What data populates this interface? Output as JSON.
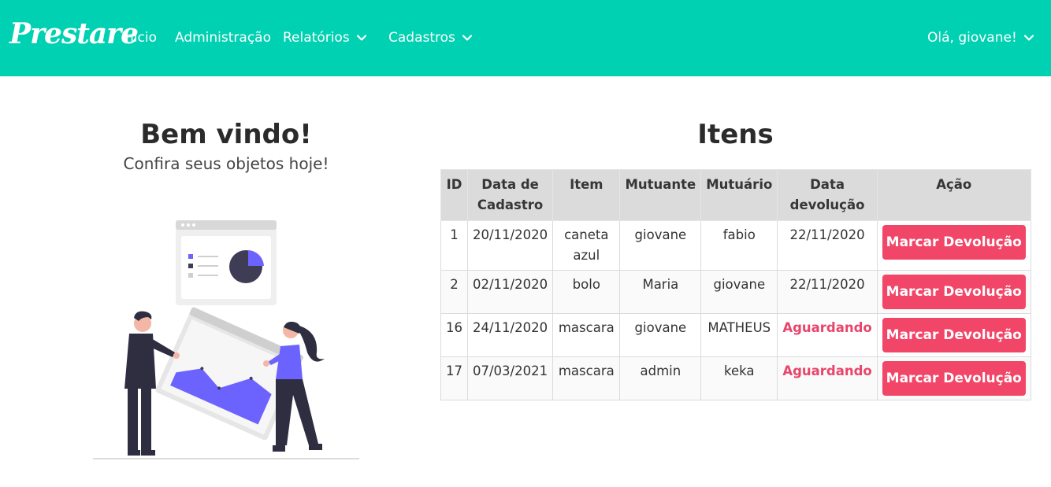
{
  "navbar": {
    "brand": "Prestare",
    "items": [
      {
        "label": "Inicio"
      },
      {
        "label": "Administração"
      },
      {
        "label": "Relatórios"
      },
      {
        "label": "Cadastros"
      }
    ],
    "user_greeting": "Olá, giovane!"
  },
  "welcome": {
    "title": "Bem vindo!",
    "subtitle": "Confira seus objetos hoje!"
  },
  "items_section": {
    "title": "Itens",
    "headers": [
      "ID",
      "Data de Cadastro",
      "Item",
      "Mutuante",
      "Mutuário",
      "Data devolução",
      "Ação"
    ],
    "rows": [
      {
        "id": "1",
        "created": "20/11/2020",
        "item": "caneta azul",
        "lender": "giovane",
        "borrower": "fabio",
        "return_date": "22/11/2020",
        "action": "Marcar Devolução"
      },
      {
        "id": "2",
        "created": "02/11/2020",
        "item": "bolo",
        "lender": "Maria",
        "borrower": "giovane",
        "return_date": "22/11/2020",
        "action": "Marcar Devolução"
      },
      {
        "id": "16",
        "created": "24/11/2020",
        "item": "mascara",
        "lender": "giovane",
        "borrower": "MATHEUS",
        "return_date": "Aguardando",
        "action": "Marcar Devolução"
      },
      {
        "id": "17",
        "created": "07/03/2021",
        "item": "mascara",
        "lender": "admin",
        "borrower": "keka",
        "return_date": "Aguardando",
        "action": "Marcar Devolução"
      }
    ]
  },
  "colors": {
    "navbar_bg": "#00d1b2",
    "button_bg": "#f14668",
    "waiting_text": "#e8456a",
    "illustration_accent": "#6c63ff"
  }
}
